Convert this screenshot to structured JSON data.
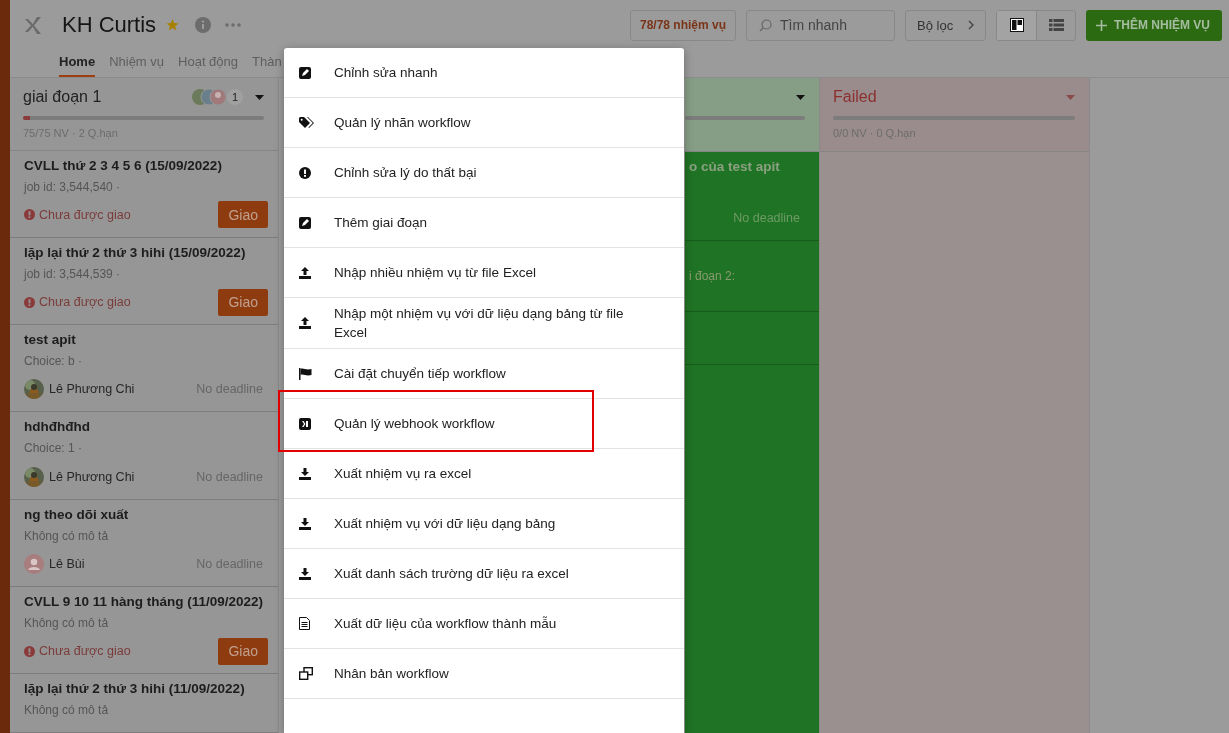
{
  "header": {
    "title": "KH Curtis",
    "starred": true,
    "tabs": [
      {
        "label": "Home",
        "selected": true
      },
      {
        "label": "Nhiệm vụ",
        "selected": false
      },
      {
        "label": "Hoạt động",
        "selected": false
      },
      {
        "label": "Thàn",
        "selected": false
      }
    ],
    "task_count": "78/78 nhiệm vụ",
    "search": {
      "placeholder": "Tìm nhanh"
    },
    "filter": "Bộ lọc",
    "views": [
      {
        "kind": "board",
        "selected": true
      },
      {
        "kind": "list",
        "selected": false
      }
    ],
    "add_button": "THÊM NHIỆM VỤ"
  },
  "columns": [
    {
      "kind": "stage",
      "title": "giai đoạn 1",
      "members": "1",
      "meta": "75/75 NV · 2 Q.hạn",
      "level": 0.03,
      "cards": [
        {
          "kind": "unassigned",
          "title": "CVLL thứ 2 3 4 5 6 (15/09/2022)",
          "detail": "job id: 3,544,540 ·",
          "status": "Chưa được giao",
          "button": "Giao"
        },
        {
          "kind": "unassigned",
          "title": "lặp lại thứ 2 thứ 3 hihi (15/09/2022)",
          "detail": "job id: 3,544,539 ·",
          "status": "Chưa được giao",
          "button": "Giao"
        },
        {
          "kind": "assigned",
          "title": "test apit",
          "detail": "Choice: b ·",
          "assignee": "Lê Phương Chi",
          "deadline": "No deadline"
        },
        {
          "kind": "assigned",
          "title": "hdhđhđhd",
          "detail": "Choice: 1 ·",
          "assignee": "Lê Phương Chi",
          "deadline": "No deadline"
        },
        {
          "kind": "assigned",
          "title": "ng theo dõi xuất",
          "detail": "Không có mô tả",
          "assignee": "Lê Bùi",
          "deadline": "No deadline"
        },
        {
          "kind": "unassigned",
          "title": "CVLL 9 10 11 hàng tháng (11/09/2022)",
          "detail": "Không có mô tả",
          "status": "Chưa được giao",
          "button": "Giao"
        },
        {
          "kind": "partial",
          "title": "lặp lại thứ 2 thứ 3 hihi (11/09/2022)",
          "detail": "Không có mô tả"
        }
      ]
    },
    {
      "kind": "done",
      "cards": [
        {
          "kind": "assigned",
          "title": "o của test apit",
          "deadline": "No deadline"
        },
        {
          "kind": "note",
          "detail": "i đoạn 2:"
        },
        {
          "kind": "empty"
        }
      ]
    },
    {
      "kind": "failed",
      "title": "Failed",
      "meta": "0/0 NV · 0 Q.hạn"
    }
  ],
  "menu": [
    {
      "label": "Chỉnh sửa nhanh",
      "highlighted": false
    },
    {
      "label": "Quản lý nhãn workflow",
      "highlighted": false
    },
    {
      "label": "Chỉnh sửa lý do thất bại",
      "highlighted": false
    },
    {
      "label": "Thêm giai đoạn",
      "highlighted": false
    },
    {
      "label": "Nhập nhiều nhiệm vụ từ file Excel",
      "highlighted": false
    },
    {
      "label": "Nhập một nhiệm vụ với dữ liệu dạng bảng từ file Excel",
      "highlighted": false
    },
    {
      "label": "Cài đặt chuyển tiếp workflow",
      "highlighted": false
    },
    {
      "label": "Quản lý webhook workflow",
      "highlighted": true
    },
    {
      "label": "Xuất nhiệm vụ ra excel",
      "highlighted": false
    },
    {
      "label": "Xuất nhiệm vụ với dữ liệu dạng bảng",
      "highlighted": false
    },
    {
      "label": "Xuất danh sách trường dữ liệu ra excel",
      "highlighted": false
    },
    {
      "label": "Xuất dữ liệu của workflow thành mẫu",
      "highlighted": false
    },
    {
      "label": "Nhân bản workflow",
      "highlighted": false
    }
  ]
}
